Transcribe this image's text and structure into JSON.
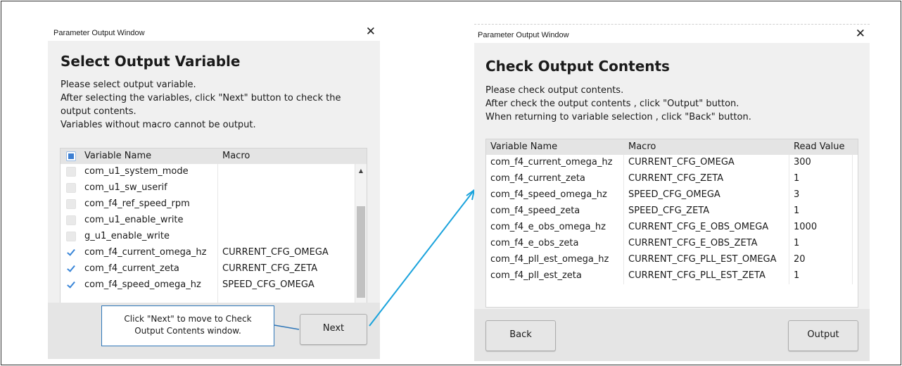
{
  "left_window": {
    "title": "Parameter Output Window",
    "close_glyph": "✕",
    "heading": "Select Output Variable",
    "description": [
      "Please select output variable.",
      "After selecting the variables, click \"Next\" button to check the",
      "output contents.",
      "Variables without macro cannot be output."
    ],
    "table": {
      "columns": [
        "Variable Name",
        "Macro"
      ],
      "rows": [
        {
          "name": "com_u1_system_mode",
          "macro": "",
          "checked": false
        },
        {
          "name": "com_u1_sw_userif",
          "macro": "",
          "checked": false
        },
        {
          "name": "com_f4_ref_speed_rpm",
          "macro": "",
          "checked": false
        },
        {
          "name": "com_u1_enable_write",
          "macro": "",
          "checked": false
        },
        {
          "name": "g_u1_enable_write",
          "macro": "",
          "checked": false
        },
        {
          "name": "com_f4_current_omega_hz",
          "macro": "CURRENT_CFG_OMEGA",
          "checked": true
        },
        {
          "name": "com_f4_current_zeta",
          "macro": "CURRENT_CFG_ZETA",
          "checked": true
        },
        {
          "name": "com_f4_speed_omega_hz",
          "macro": "SPEED_CFG_OMEGA",
          "checked": true
        }
      ]
    },
    "next_label": "Next",
    "callout_lines": [
      "Click \"Next\" to move to Check",
      "Output Contents window."
    ]
  },
  "right_window": {
    "title": "Parameter Output Window",
    "close_glyph": "✕",
    "heading": "Check Output Contents",
    "description": [
      "Please check output contents.",
      "After check the output contents , click \"Output\" button.",
      "When returning to variable selection , click \"Back\" button."
    ],
    "table": {
      "columns": [
        "Variable Name",
        "Macro",
        "Read Value"
      ],
      "rows": [
        {
          "name": "com_f4_current_omega_hz",
          "macro": "CURRENT_CFG_OMEGA",
          "value": "300"
        },
        {
          "name": "com_f4_current_zeta",
          "macro": "CURRENT_CFG_ZETA",
          "value": "1"
        },
        {
          "name": "com_f4_speed_omega_hz",
          "macro": "SPEED_CFG_OMEGA",
          "value": "3"
        },
        {
          "name": "com_f4_speed_zeta",
          "macro": "SPEED_CFG_ZETA",
          "value": "1"
        },
        {
          "name": "com_f4_e_obs_omega_hz",
          "macro": "CURRENT_CFG_E_OBS_OMEGA",
          "value": "1000"
        },
        {
          "name": "com_f4_e_obs_zeta",
          "macro": "CURRENT_CFG_E_OBS_ZETA",
          "value": "1"
        },
        {
          "name": "com_f4_pll_est_omega_hz",
          "macro": "CURRENT_CFG_PLL_EST_OMEGA",
          "value": "20"
        },
        {
          "name": "com_f4_pll_est_zeta",
          "macro": "CURRENT_CFG_PLL_EST_ZETA",
          "value": "1"
        }
      ]
    },
    "back_label": "Back",
    "output_label": "Output"
  },
  "colors": {
    "arrow": "#1aa3dc",
    "callout_border": "#2e76b8",
    "check": "#3a86d8"
  }
}
